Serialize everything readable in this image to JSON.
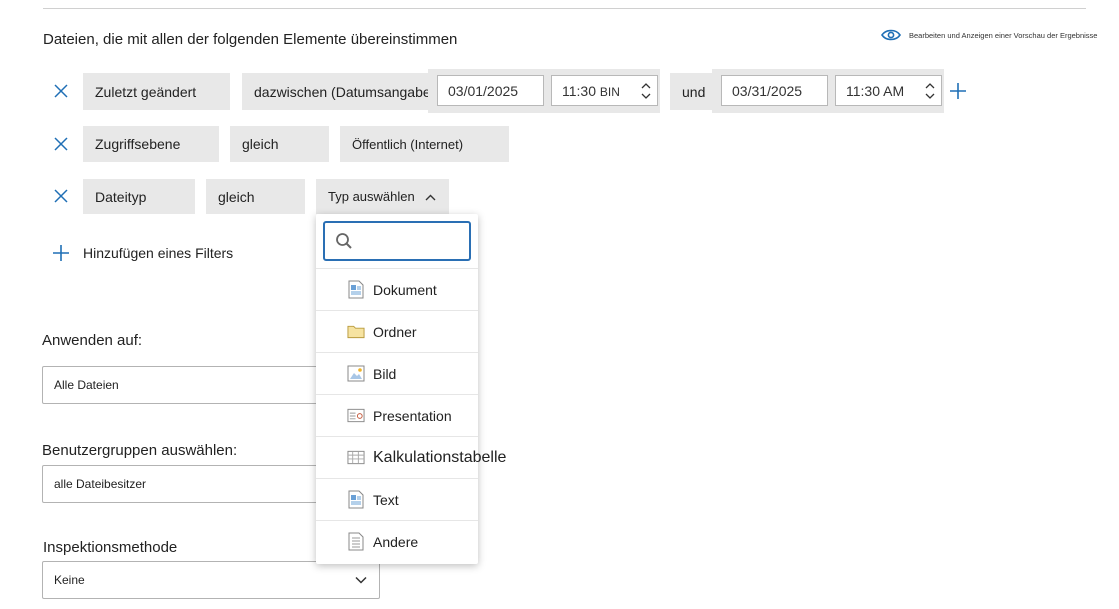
{
  "heading": "Dateien, die mit allen der folgenden Elemente übereinstimmen",
  "preview_link": "Bearbeiten und Anzeigen einer Vorschau der Ergebnisse",
  "filters": {
    "row1": {
      "field": "Zuletzt geändert",
      "operator": "dazwischen (Datumsangaben)",
      "start_date": "03/01/2025",
      "start_time": "11:30",
      "start_ampm": "BIN",
      "connector": "und",
      "end_date": "03/31/2025",
      "end_time": "11:30 AM"
    },
    "row2": {
      "field": "Zugriffsebene",
      "operator": "gleich",
      "value": "Öffentlich (Internet)"
    },
    "row3": {
      "field": "Dateityp",
      "operator": "gleich",
      "value": "Typ auswählen"
    }
  },
  "add_filter": "Hinzufügen eines Filters",
  "apply_to": {
    "label": "Anwenden auf:",
    "value": "Alle Dateien"
  },
  "user_groups": {
    "label": "Benutzergruppen auswählen:",
    "value": "alle Dateibesitzer"
  },
  "inspection": {
    "label": "Inspektionsmethode",
    "value": "Keine"
  },
  "dropdown": {
    "search_placeholder": "",
    "items": [
      {
        "label": "Dokument",
        "icon": "document-icon"
      },
      {
        "label": "Ordner",
        "icon": "folder-icon"
      },
      {
        "label": "Bild",
        "icon": "image-icon"
      },
      {
        "label": "Presentation",
        "icon": "presentation-icon"
      },
      {
        "label": "Kalkulationstabelle",
        "icon": "spreadsheet-icon"
      },
      {
        "label": "Text",
        "icon": "text-file-icon"
      },
      {
        "label": "Andere",
        "icon": "other-file-icon"
      }
    ]
  },
  "colors": {
    "accent": "#1f6fb5",
    "chip_bg": "#e8e8e8",
    "focus_border": "#2a6fb4"
  }
}
